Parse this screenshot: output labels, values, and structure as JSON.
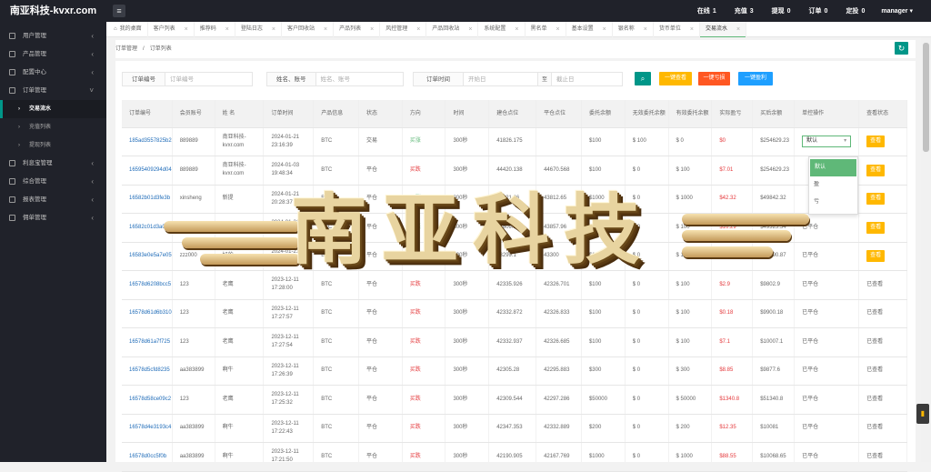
{
  "app": {
    "title": "南亚科技-kvxr.com",
    "user": "manager"
  },
  "top_stats": [
    {
      "label": "在线",
      "value": "1"
    },
    {
      "label": "充值",
      "value": "3"
    },
    {
      "label": "提现",
      "value": "0"
    },
    {
      "label": "订单",
      "value": "0"
    },
    {
      "label": "定投",
      "value": "0"
    }
  ],
  "sidebar": {
    "items": [
      {
        "label": "用户管理",
        "chevron": "‹"
      },
      {
        "label": "产品管理",
        "chevron": "‹"
      },
      {
        "label": "配置中心",
        "chevron": "‹"
      },
      {
        "label": "订单管理",
        "chevron": "˅"
      }
    ],
    "sub_items": [
      {
        "label": "交易流水"
      },
      {
        "label": "充值列表"
      },
      {
        "label": "提现列表"
      }
    ],
    "items2": [
      {
        "label": "利息宝管理",
        "chevron": "‹"
      },
      {
        "label": "综合管理",
        "chevron": "‹"
      },
      {
        "label": "报表管理",
        "chevron": "‹"
      },
      {
        "label": "佣单管理",
        "chevron": "‹"
      }
    ]
  },
  "tabs": [
    {
      "label": "我的桌面"
    },
    {
      "label": "客户列表"
    },
    {
      "label": "推荐码"
    },
    {
      "label": "登陆日志"
    },
    {
      "label": "客户回收站"
    },
    {
      "label": "产品列表"
    },
    {
      "label": "风控管理"
    },
    {
      "label": "产品回收站"
    },
    {
      "label": "系统配置"
    },
    {
      "label": "黑名单"
    },
    {
      "label": "基本设置"
    },
    {
      "label": "银名称"
    },
    {
      "label": "货币单位"
    },
    {
      "label": "交易流水"
    }
  ],
  "breadcrumb": {
    "root": "订单管理",
    "sep": "/",
    "current": "订单列表"
  },
  "filters": {
    "order_no_label": "订单编号",
    "order_no_placeholder": "订单编号",
    "name_label": "姓名、账号",
    "name_placeholder": "姓名、账号",
    "time_label": "订单时间",
    "start_placeholder": "开始日",
    "to": "至",
    "end_placeholder": "截止日"
  },
  "buttons": {
    "search": "⌕",
    "check_all": "一键查看",
    "lose_all": "一键亏损",
    "win_all": "一键盈利",
    "refresh": "↻"
  },
  "colors": {
    "accent": "#009688",
    "yellow": "#ffb800",
    "orange": "#ff5722",
    "blue": "#1e9fff",
    "green": "#5fb878"
  },
  "table": {
    "headers": [
      "订单编号",
      "会员账号",
      "姓 名",
      "订单时间",
      "产品信息",
      "状态",
      "方向",
      "时间",
      "建仓点位",
      "平仓点位",
      "委托余额",
      "无效委托余额",
      "有效委托余额",
      "实际盈亏",
      "买后余额",
      "单控操作",
      "查看状态"
    ],
    "rows": [
      [
        "185ad3557825b2",
        "889889",
        "南亚科技-kvxr.com",
        "2024-01-21 23:16:39",
        "BTC",
        "交易",
        "买涨",
        "300秒",
        "41826.175",
        "",
        "$100",
        "$ 100",
        "$ 0",
        "$0",
        "$254629.23",
        "select",
        "查看"
      ],
      [
        "16595409294d04",
        "889889",
        "南亚科技-kvxr.com",
        "2024-01-03 19:48:34",
        "BTC",
        "平仓",
        "买跌",
        "300秒",
        "44420.138",
        "44670.568",
        "$100",
        "$ 0",
        "$ 100",
        "$7.01",
        "$254629.23",
        "",
        "查看"
      ],
      [
        "16582b01d3fe3b",
        "xinsheng",
        "新提",
        "2024-01-21 20:28:37",
        "BTC",
        "平仓",
        "买涨",
        "300秒",
        "43821.36",
        "43812.65",
        "$1000",
        "$ 0",
        "$ 1000",
        "$42.32",
        "$49842.32",
        "",
        "查看"
      ],
      [
        "16582c01d3a0a6",
        "",
        "新提",
        "2024-01-21 20:28:37",
        "BTC",
        "平仓",
        "买涨",
        "300秒",
        "43809.11",
        "43857.96",
        "$100",
        "$ 0",
        "$ 100",
        "$16.29",
        "$49325.54",
        "已平仓",
        "查看"
      ],
      [
        "16583e0e5a7e05",
        "zzz000",
        "好的",
        "2024-01-21 20:13:06",
        "BTC",
        "平仓",
        "买涨",
        "300秒",
        "43299.1",
        "43300",
        "$100",
        "$ 0",
        "$ 100",
        "$2.87",
        "$88890.87",
        "已平仓",
        "查看"
      ],
      [
        "16578d6208bcc5",
        "123",
        "老鹰",
        "2023-12-11 17:28:00",
        "BTC",
        "平仓",
        "买跌",
        "300秒",
        "42335.926",
        "42326.701",
        "$100",
        "$ 0",
        "$ 100",
        "$2.9",
        "$9802.9",
        "已平仓",
        "已查看"
      ],
      [
        "16578d61d6b310",
        "123",
        "老鹰",
        "2023-12-11 17:27:57",
        "BTC",
        "平仓",
        "买跌",
        "300秒",
        "42332.872",
        "42326.833",
        "$100",
        "$ 0",
        "$ 100",
        "$0.18",
        "$9900.18",
        "已平仓",
        "已查看"
      ],
      [
        "16578d61a7f725",
        "123",
        "老鹰",
        "2023-12-11 17:27:54",
        "BTC",
        "平仓",
        "买跌",
        "300秒",
        "42332.937",
        "42326.685",
        "$100",
        "$ 0",
        "$ 100",
        "$7.1",
        "$10007.1",
        "已平仓",
        "已查看"
      ],
      [
        "16578d5cfd8235",
        "aa383899",
        "啊牛",
        "2023-12-11 17:26:39",
        "BTC",
        "平仓",
        "买跌",
        "300秒",
        "42305.28",
        "42295.883",
        "$300",
        "$ 0",
        "$ 300",
        "$8.85",
        "$9877.6",
        "已平仓",
        "已查看"
      ],
      [
        "16578d58ce09c2",
        "123",
        "老鹰",
        "2023-12-11 17:25:32",
        "BTC",
        "平仓",
        "买跌",
        "300秒",
        "42309.544",
        "42297.286",
        "$50000",
        "$ 0",
        "$ 50000",
        "$1340.8",
        "$51340.8",
        "已平仓",
        "已查看"
      ],
      [
        "16578d4e3193c4",
        "aa383899",
        "啊牛",
        "2023-12-11 17:22:43",
        "BTC",
        "平仓",
        "买跌",
        "300秒",
        "42347.353",
        "42332.889",
        "$200",
        "$ 0",
        "$ 200",
        "$12.35",
        "$10081",
        "已平仓",
        "已查看"
      ],
      [
        "16578d0cc5f0b",
        "aa383899",
        "啊牛",
        "2023-12-11 17:21:50",
        "BTC",
        "平仓",
        "买跌",
        "300秒",
        "42190.905",
        "42167.769",
        "$1000",
        "$ 0",
        "$ 1000",
        "$88.55",
        "$10068.65",
        "已平仓",
        "已查看"
      ]
    ]
  },
  "select_control": {
    "value": "默认",
    "options": [
      "默认",
      "盈",
      "亏"
    ]
  },
  "watermark": {
    "text": "南亚科技"
  }
}
